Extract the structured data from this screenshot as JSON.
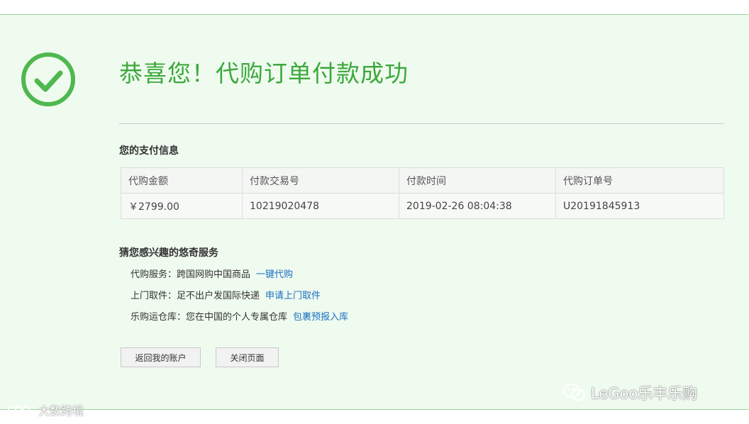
{
  "header": {
    "title": "恭喜您！代购订单付款成功"
  },
  "payment_info": {
    "section_title": "您的支付信息",
    "columns": [
      "代购金额",
      "付款交易号",
      "付款时间",
      "代购订单号"
    ],
    "row": {
      "amount": "￥2799.00",
      "transaction_no": "10219020478",
      "pay_time": "2019-02-26 08:04:38",
      "order_no": "U20191845913"
    }
  },
  "services": {
    "section_title": "猜您感兴趣的悠奇服务",
    "items": [
      {
        "label": "代购服务：跨国网购中国商品",
        "link": "一键代购"
      },
      {
        "label": "上门取件：足不出户发国际快递",
        "link": "申请上门取件"
      },
      {
        "label": "乐购运仓库：您在中国的个人专属仓库",
        "link": "包裹预报入库"
      }
    ]
  },
  "buttons": {
    "back": "返回我的账户",
    "close": "关闭页面"
  },
  "watermarks": {
    "right": "LeGoo乐丰乐购",
    "left": "大数跨境"
  },
  "colors": {
    "panel_bg": "#effbef",
    "accent_green": "#3ca83c",
    "amount_red": "#c21f1f",
    "link_blue": "#1b6fc2"
  },
  "icons": {
    "success": "check-circle-icon",
    "wechat": "wechat-icon"
  }
}
